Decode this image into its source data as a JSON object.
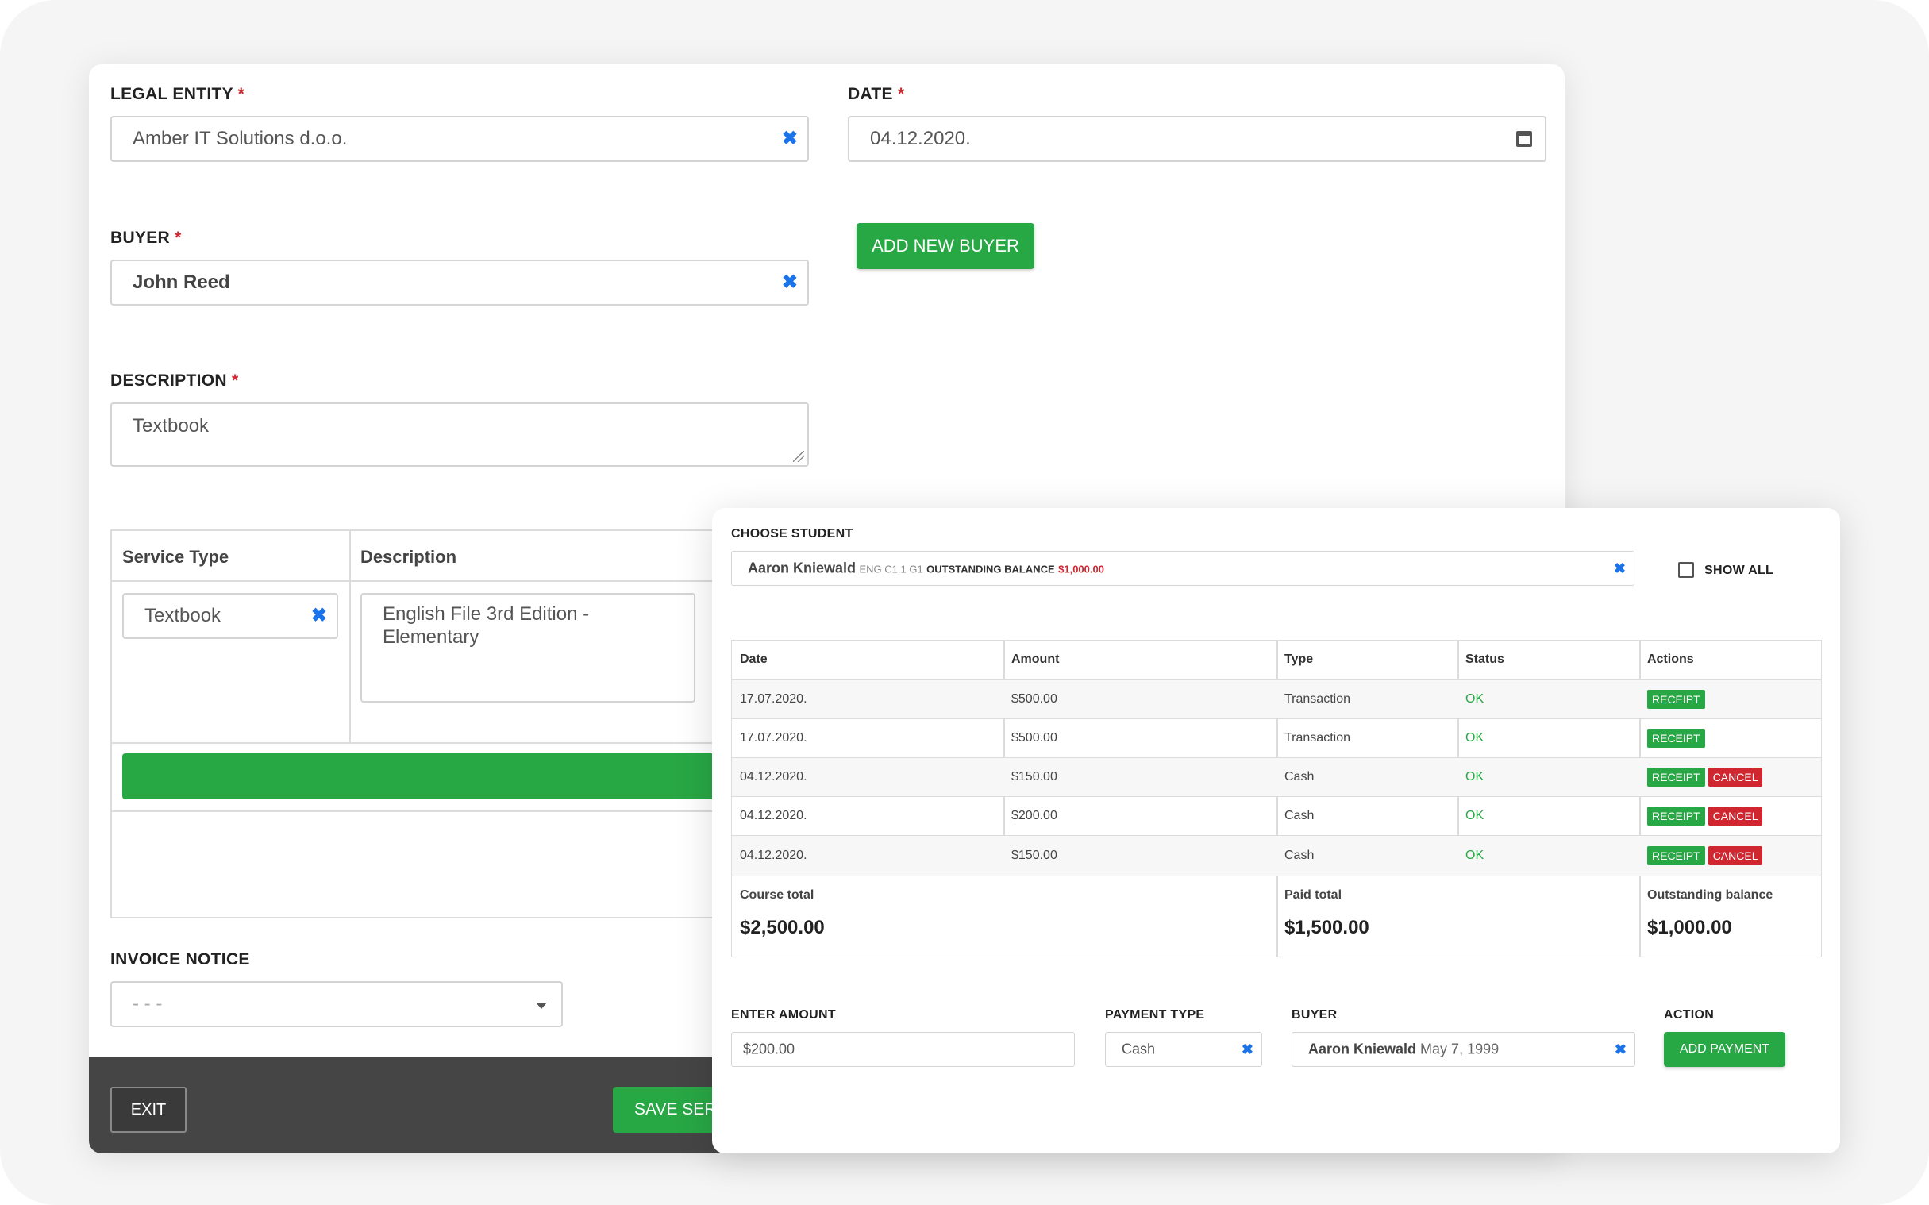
{
  "invoice_form": {
    "legal_entity": {
      "label": "LEGAL ENTITY",
      "required_mark": "*",
      "value": "Amber IT Solutions d.o.o."
    },
    "date": {
      "label": "DATE",
      "required_mark": "*",
      "value": "04.12.2020."
    },
    "buyer": {
      "label": "BUYER",
      "required_mark": "*",
      "value": "John Reed"
    },
    "add_new_buyer_label": "ADD NEW BUYER",
    "description": {
      "label": "DESCRIPTION",
      "required_mark": "*",
      "value": "Textbook"
    },
    "services_table": {
      "headers": [
        "Service Type",
        "Description"
      ],
      "row": {
        "service_type": "Textbook",
        "description_line1": "English File 3rd Edition -",
        "description_line2": "Elementary"
      }
    },
    "invoice_notice": {
      "label": "INVOICE NOTICE",
      "value": "- - -"
    },
    "footer": {
      "exit_label": "EXIT",
      "save_label": "SAVE SERV"
    }
  },
  "payment_panel": {
    "choose_student": {
      "label": "CHOOSE STUDENT",
      "student_name": "Aaron Kniewald",
      "student_group": "ENG C1.1 G1",
      "balance_label": "OUTSTANDING BALANCE",
      "balance_value": "$1,000.00"
    },
    "show_all_label": "SHOW ALL",
    "table": {
      "headers": [
        "Date",
        "Amount",
        "Type",
        "Status",
        "Actions"
      ],
      "rows": [
        {
          "date": "17.07.2020.",
          "amount": "$500.00",
          "type": "Transaction",
          "status": "OK",
          "receipt": "RECEIPT",
          "cancel": ""
        },
        {
          "date": "17.07.2020.",
          "amount": "$500.00",
          "type": "Transaction",
          "status": "OK",
          "receipt": "RECEIPT",
          "cancel": ""
        },
        {
          "date": "04.12.2020.",
          "amount": "$150.00",
          "type": "Cash",
          "status": "OK",
          "receipt": "RECEIPT",
          "cancel": "CANCEL"
        },
        {
          "date": "04.12.2020.",
          "amount": "$200.00",
          "type": "Cash",
          "status": "OK",
          "receipt": "RECEIPT",
          "cancel": "CANCEL"
        },
        {
          "date": "04.12.2020.",
          "amount": "$150.00",
          "type": "Cash",
          "status": "OK",
          "receipt": "RECEIPT",
          "cancel": "CANCEL"
        }
      ],
      "totals": {
        "course_total_label": "Course total",
        "course_total": "$2,500.00",
        "paid_total_label": "Paid total",
        "paid_total": "$1,500.00",
        "outstanding_label": "Outstanding balance",
        "outstanding": "$1,000.00"
      }
    },
    "enter_amount": {
      "label": "ENTER AMOUNT",
      "value": "$200.00"
    },
    "payment_type": {
      "label": "PAYMENT TYPE",
      "value": "Cash"
    },
    "buyer": {
      "label": "BUYER",
      "name": "Aaron Kniewald",
      "dob": "May 7, 1999"
    },
    "action": {
      "label": "ACTION",
      "button": "ADD PAYMENT"
    }
  },
  "colors": {
    "accent_green": "#28a745",
    "danger_red": "#d0262f",
    "clear_blue": "#1a73e8",
    "footer_dark": "#454545"
  }
}
